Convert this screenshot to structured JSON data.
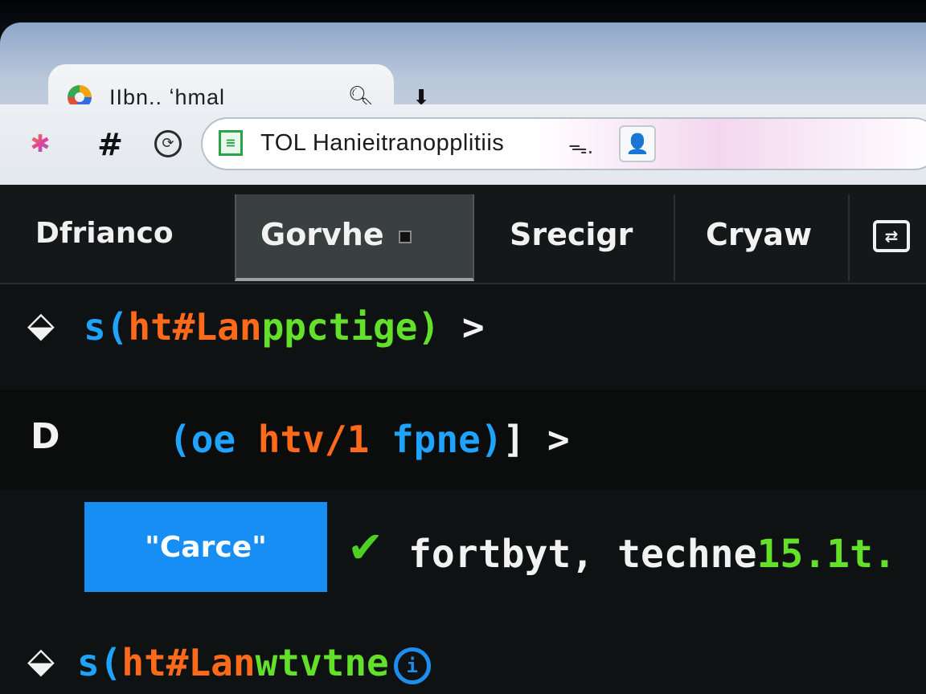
{
  "browser": {
    "tab_title": "IIbn.. ʻhmal",
    "tab_search_icon": "search-icon",
    "address": "TOL Hanieitranopplitiis",
    "address_key_glyph": "ᯓ.",
    "profile_glyph": "👤"
  },
  "nav": {
    "brand": "Dfrianco",
    "tabs": [
      {
        "label": "Gorvhe",
        "active": true
      },
      {
        "label": "Srecigr",
        "active": false
      },
      {
        "label": "Cryaw",
        "active": false
      }
    ]
  },
  "code": {
    "line1": {
      "open": "s(",
      "tag": "ht#Lan",
      "attr": "ppctige",
      "close": ")",
      "arrow": ">"
    },
    "line2": {
      "label": "D",
      "open": "(oe",
      "tag": "htv/1",
      "attr": "fpne)",
      "close": "]",
      "arrow": ">"
    },
    "line4": {
      "open": "s(",
      "tag": "ht#Lan",
      "attr": "wtvtne"
    }
  },
  "action": {
    "button_label": "\"Carce\"",
    "status_text": "fortbyt, techne",
    "status_value": "15.1t."
  },
  "colors": {
    "accent_blue": "#168ef4",
    "keyword_orange": "#ff6a1a",
    "string_green": "#62e02a"
  }
}
